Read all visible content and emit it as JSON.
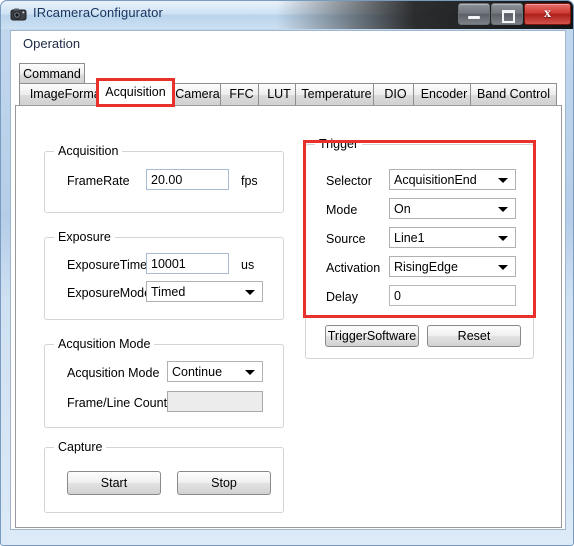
{
  "window": {
    "title": "IRcameraConfigurator",
    "icon": "camera-icon",
    "minimize_label": "",
    "maximize_label": "",
    "close_label": "x"
  },
  "menubar": {
    "items": [
      {
        "label": "Operation"
      }
    ]
  },
  "tabs": {
    "row1": [
      {
        "label": "Command",
        "selected": false
      }
    ],
    "row2": [
      {
        "label": "ImageFormat",
        "selected": false
      },
      {
        "label": "Acquisition",
        "selected": true,
        "highlighted": true
      },
      {
        "label": "Camera",
        "selected": false
      },
      {
        "label": "FFC",
        "selected": false
      },
      {
        "label": "LUT",
        "selected": false
      },
      {
        "label": "Temperature",
        "selected": false
      },
      {
        "label": "DIO",
        "selected": false
      },
      {
        "label": "Encoder",
        "selected": false
      },
      {
        "label": "Band Control",
        "selected": false
      }
    ]
  },
  "acquisition_group": {
    "title": "Acquisition",
    "framerate_label": "FrameRate",
    "framerate_value": "20.00",
    "framerate_unit": "fps"
  },
  "exposure_group": {
    "title": "Exposure",
    "exposure_time_label": "ExposureTime",
    "exposure_time_value": "10001",
    "exposure_time_unit": "us",
    "exposure_mode_label": "ExposureMode",
    "exposure_mode_value": "Timed"
  },
  "acquisition_mode_group": {
    "title": "Acqusition Mode",
    "mode_label": "Acqusition Mode",
    "mode_value": "Continue",
    "frame_line_count_label": "Frame/Line Count",
    "frame_line_count_value": ""
  },
  "capture_group": {
    "title": "Capture",
    "start_label": "Start",
    "stop_label": "Stop"
  },
  "trigger_group": {
    "title": "Trigger",
    "selector_label": "Selector",
    "selector_value": "AcquisitionEnd",
    "mode_label": "Mode",
    "mode_value": "On",
    "source_label": "Source",
    "source_value": "Line1",
    "activation_label": "Activation",
    "activation_value": "RisingEdge",
    "delay_label": "Delay",
    "delay_value": "0",
    "trigger_software_label": "TriggerSoftware",
    "reset_label": "Reset"
  },
  "colors": {
    "highlight": "#e8312a",
    "titlebar_text": "#16335e",
    "field_border": "#a7bcd3"
  }
}
